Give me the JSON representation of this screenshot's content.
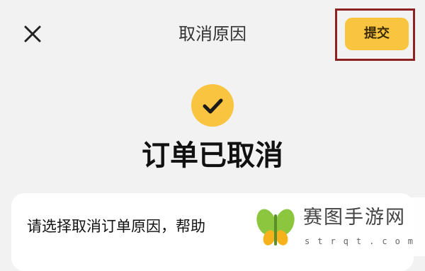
{
  "header": {
    "close_icon": "close-icon",
    "title": "取消原因",
    "submit_label": "提交"
  },
  "status": {
    "icon": "check-icon",
    "text": "订单已取消"
  },
  "card": {
    "prompt": "请选择取消订单原因，帮助"
  },
  "watermark": {
    "name": "赛图手游网",
    "domain": "strqt.com"
  },
  "colors": {
    "accent": "#f9c440",
    "highlight_box": "#8d2222",
    "background": "#f2f2f2",
    "card": "#ffffff"
  }
}
